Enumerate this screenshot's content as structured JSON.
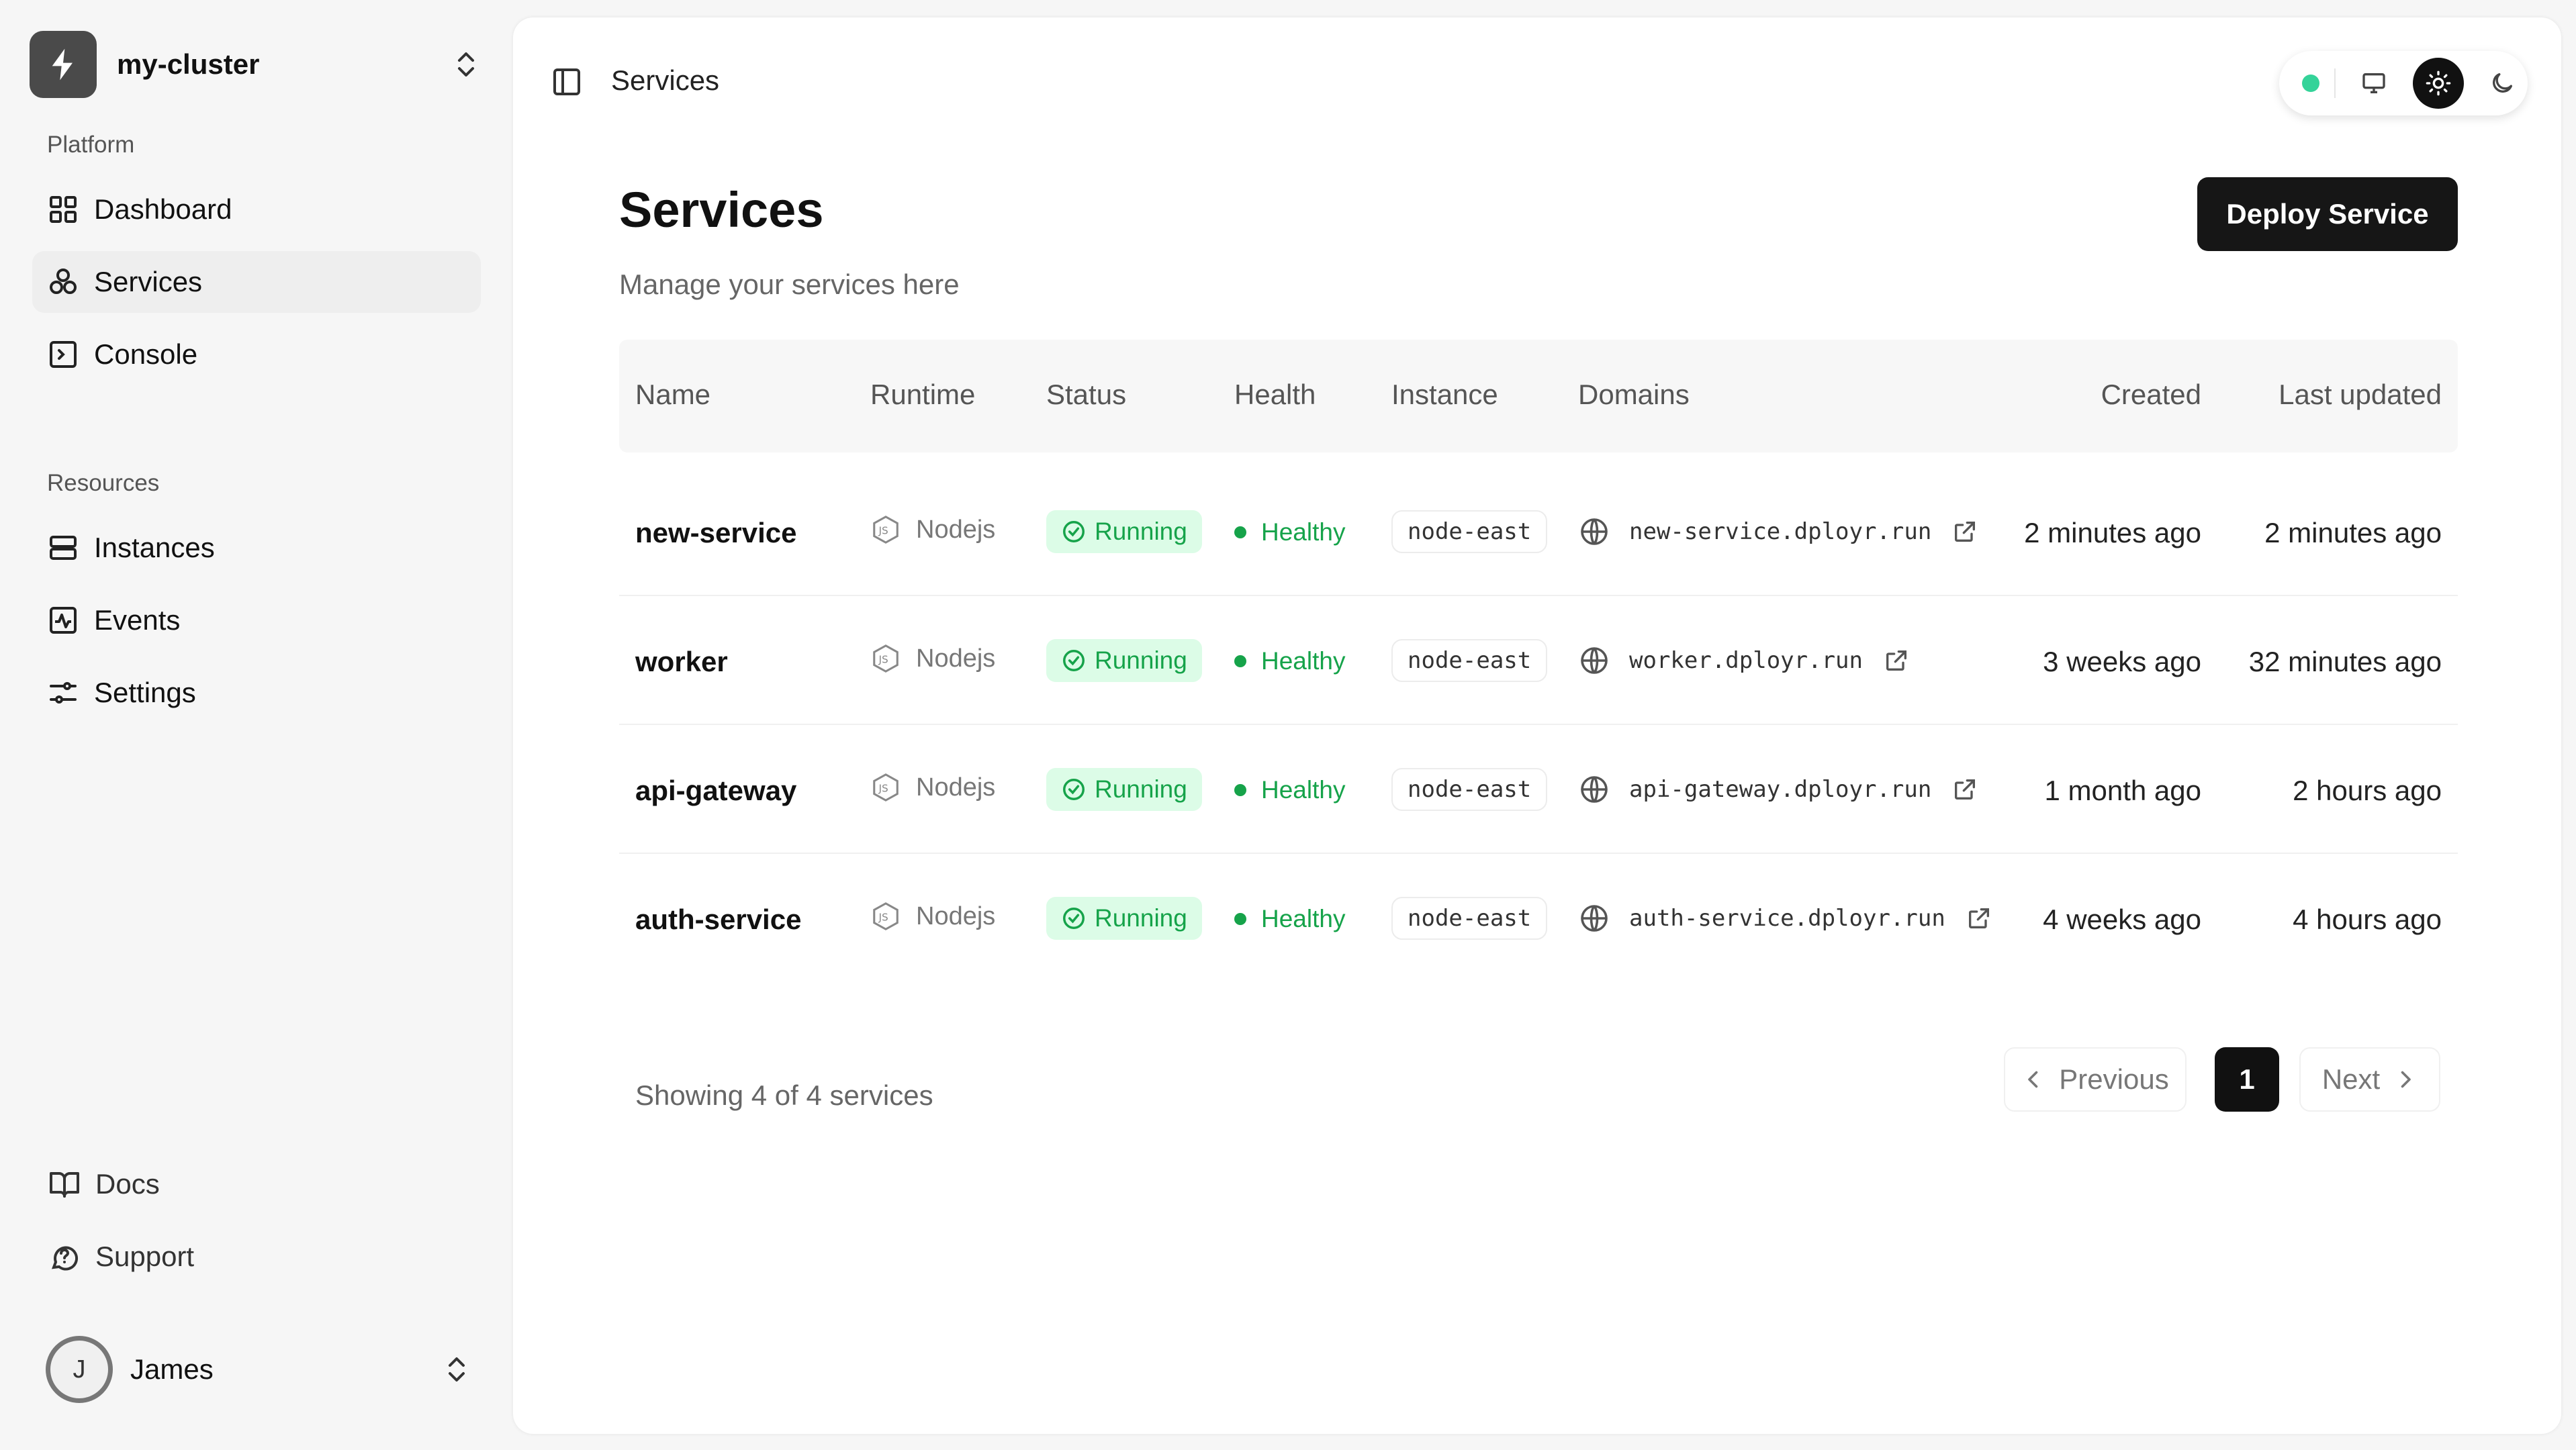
{
  "cluster": {
    "name": "my-cluster",
    "icon": "bolt-icon"
  },
  "sidebar": {
    "platform_label": "Platform",
    "platform_items": [
      {
        "label": "Dashboard",
        "icon": "grid-icon",
        "active": false
      },
      {
        "label": "Services",
        "icon": "services-icon",
        "active": true
      },
      {
        "label": "Console",
        "icon": "terminal-icon",
        "active": false
      }
    ],
    "resources_label": "Resources",
    "resources_items": [
      {
        "label": "Instances",
        "icon": "server-icon"
      },
      {
        "label": "Events",
        "icon": "activity-icon"
      },
      {
        "label": "Settings",
        "icon": "sliders-icon"
      }
    ],
    "footer_items": [
      {
        "label": "Docs",
        "icon": "book-icon"
      },
      {
        "label": "Support",
        "icon": "help-icon"
      }
    ],
    "user": {
      "initial": "J",
      "name": "James"
    }
  },
  "topbar": {
    "title": "Services",
    "status_color": "#34d399"
  },
  "page": {
    "title": "Services",
    "subtitle": "Manage your services here",
    "deploy_label": "Deploy Service"
  },
  "table": {
    "headers": [
      "Name",
      "Runtime",
      "Status",
      "Health",
      "Instance",
      "Domains",
      "Created",
      "Last updated"
    ],
    "rows": [
      {
        "name": "new-service",
        "runtime": "Nodejs",
        "status": "Running",
        "health": "Healthy",
        "instance": "node-east",
        "domain": "new-service.dployr.run",
        "created": "2 minutes ago",
        "updated": "2 minutes ago"
      },
      {
        "name": "worker",
        "runtime": "Nodejs",
        "status": "Running",
        "health": "Healthy",
        "instance": "node-east",
        "domain": "worker.dployr.run",
        "created": "3 weeks ago",
        "updated": "32 minutes ago"
      },
      {
        "name": "api-gateway",
        "runtime": "Nodejs",
        "status": "Running",
        "health": "Healthy",
        "instance": "node-east",
        "domain": "api-gateway.dployr.run",
        "created": "1 month ago",
        "updated": "2 hours ago"
      },
      {
        "name": "auth-service",
        "runtime": "Nodejs",
        "status": "Running",
        "health": "Healthy",
        "instance": "node-east",
        "domain": "auth-service.dployr.run",
        "created": "4 weeks ago",
        "updated": "4 hours ago"
      }
    ]
  },
  "pagination": {
    "summary": "Showing 4 of 4 services",
    "previous": "Previous",
    "current": "1",
    "next": "Next"
  },
  "colors": {
    "accent": "#161616",
    "success": "#16a34a",
    "success_bg": "#dcfce7"
  }
}
